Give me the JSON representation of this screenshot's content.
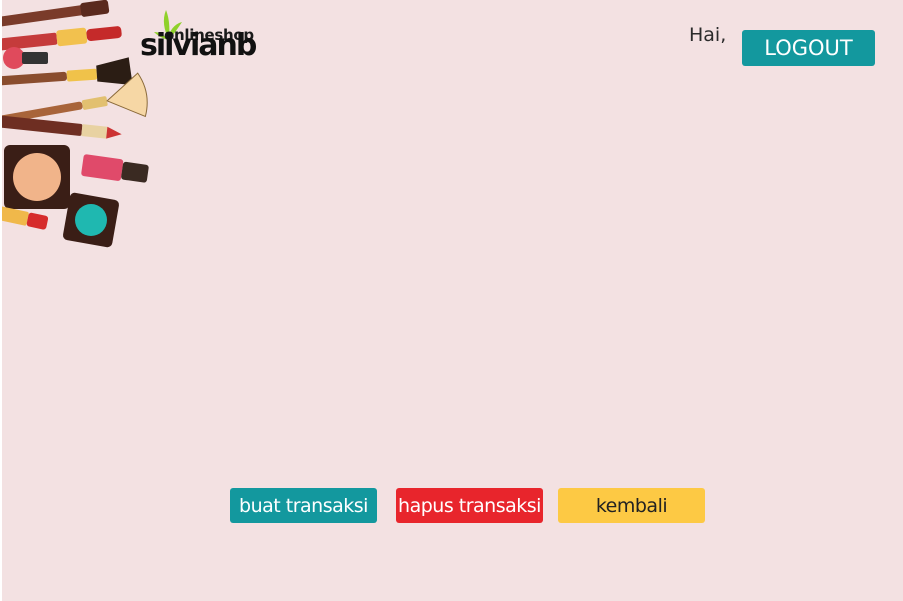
{
  "header": {
    "logo": {
      "tagline": "onlineshop",
      "brand": "silvianb"
    },
    "greeting": "Hai,",
    "logout_label": "LOGOUT"
  },
  "actions": {
    "create_label": "buat transaksi",
    "delete_label": "hapus transaksi",
    "back_label": "kembali"
  },
  "colors": {
    "background": "#f3e1e2",
    "teal": "#13989e",
    "red": "#e8252c",
    "yellow": "#fdc944",
    "logo_leaf": "#8fd12a"
  },
  "icons": [
    "cosmetics-illustration",
    "leaf-icon"
  ]
}
